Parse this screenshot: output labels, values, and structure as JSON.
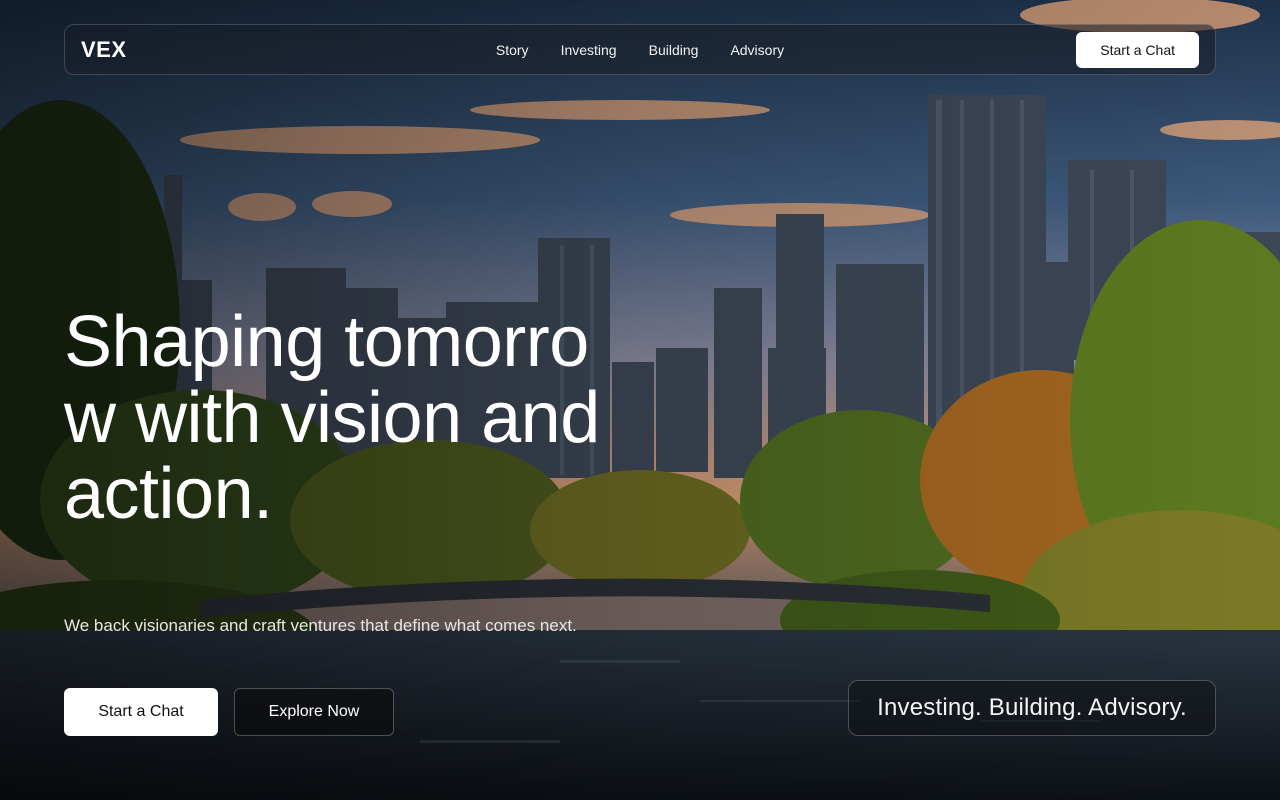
{
  "brand": {
    "logo": "VEX"
  },
  "nav": {
    "links": [
      "Story",
      "Investing",
      "Building",
      "Advisory"
    ],
    "cta_label": "Start a Chat"
  },
  "hero": {
    "headline": "Shaping tomorrow with vision and action.",
    "subline": "We back visionaries and craft ventures that define what comes next.",
    "primary_button": "Start a Chat",
    "secondary_button": "Explore Now",
    "tagline": "Investing. Building. Advisory."
  },
  "colors": {
    "sky_top": "#1f3550",
    "sky_horizon": "#d99a6a",
    "foliage": "#3f5f1e",
    "water": "#141c22",
    "button_bg": "#ffffff"
  }
}
